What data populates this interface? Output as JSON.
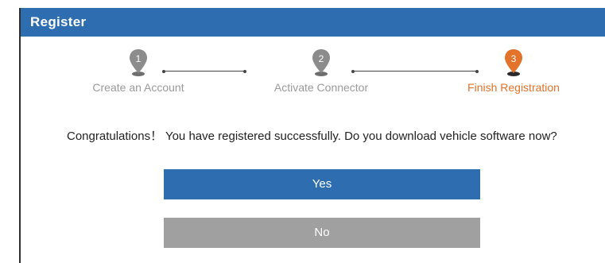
{
  "window": {
    "title": "Register"
  },
  "steps": [
    {
      "number": "1",
      "label": "Create an Account",
      "state": "inactive",
      "icon": "location-pin-icon"
    },
    {
      "number": "2",
      "label": "Activate Connector",
      "state": "inactive",
      "icon": "location-pin-icon"
    },
    {
      "number": "3",
      "label": "Finish Registration",
      "state": "active",
      "icon": "location-pin-icon"
    }
  ],
  "message": "Congratulations！ You have registered successfully. Do you download vehicle software now?",
  "buttons": {
    "yes": "Yes",
    "no": "No"
  },
  "colors": {
    "title_bar": "#2e6db0",
    "active_step": "#e3722b",
    "inactive_step": "#9a9a9a",
    "yes_button": "#2e6db0",
    "no_button": "#a0a0a0"
  }
}
